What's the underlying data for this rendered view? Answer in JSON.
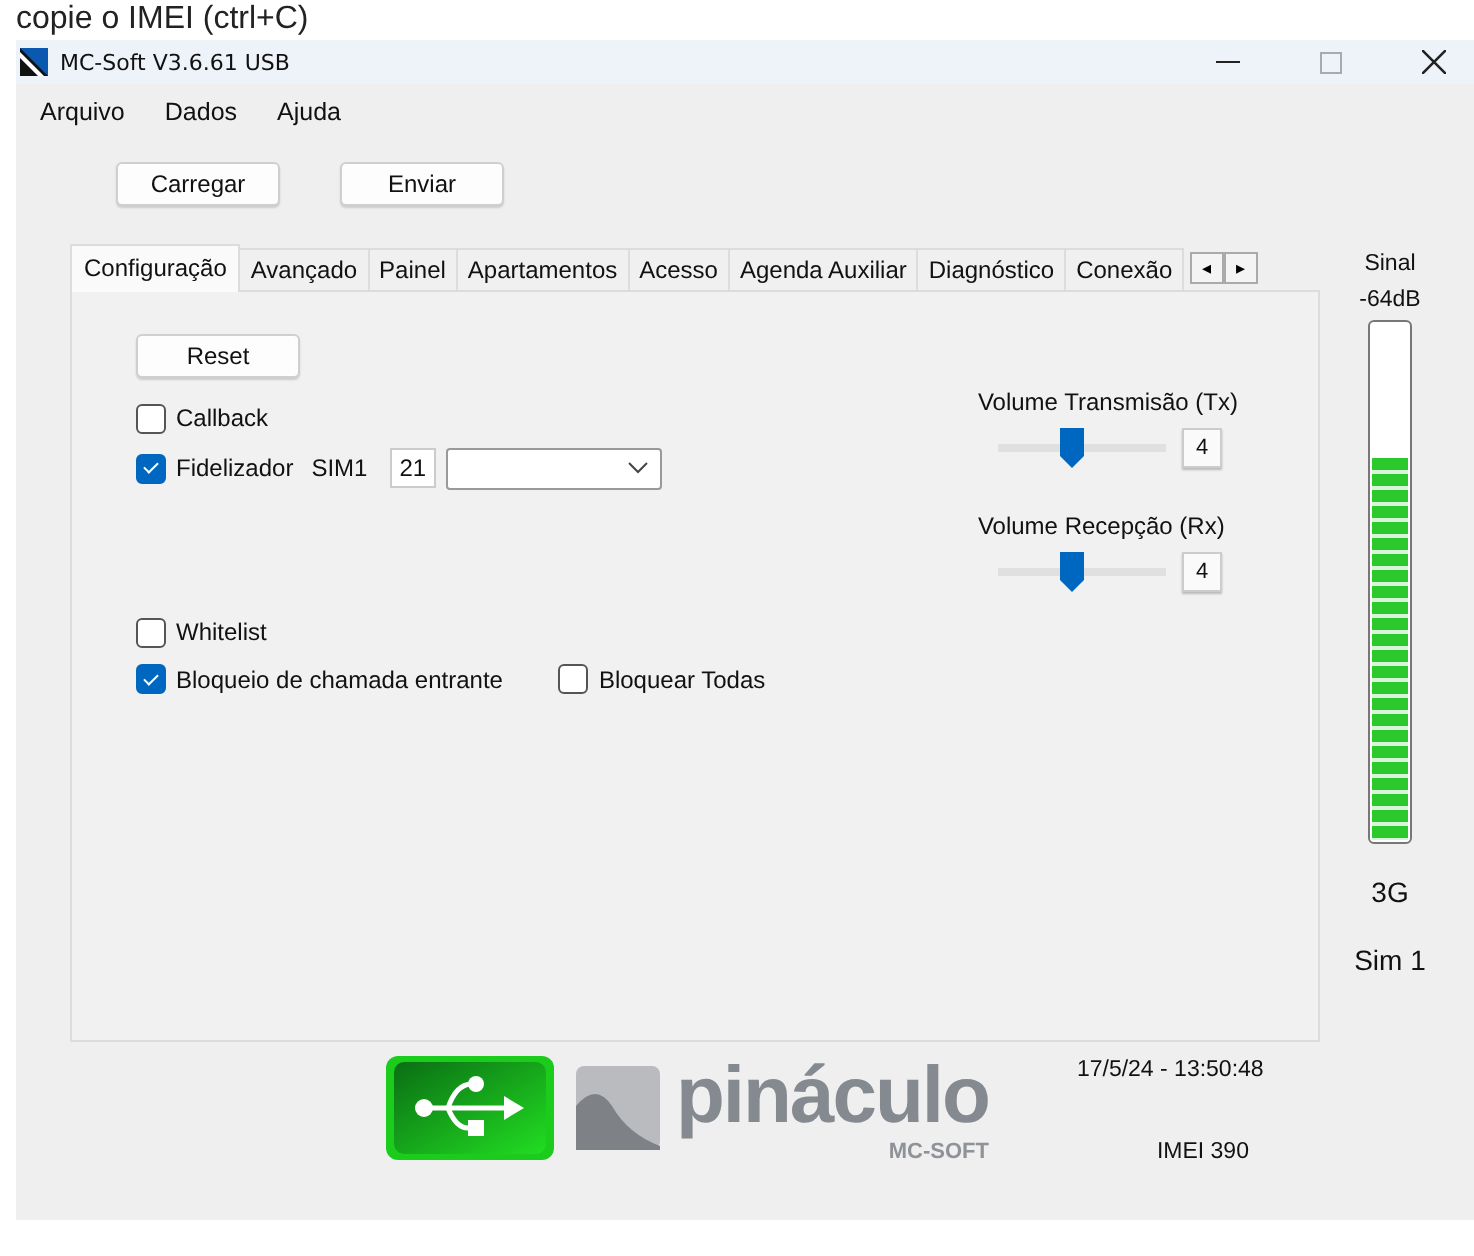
{
  "caption": "copie o IMEI (ctrl+C)",
  "window": {
    "title": "MC-Soft V3.6.61 USB"
  },
  "menu": [
    "Arquivo",
    "Dados",
    "Ajuda"
  ],
  "toolbar_buttons": [
    "Carregar",
    "Enviar"
  ],
  "tabs": [
    {
      "label": "Configuração",
      "selected": true
    },
    {
      "label": "Avançado",
      "selected": false
    },
    {
      "label": "Painel",
      "selected": false
    },
    {
      "label": "Apartamentos",
      "selected": false
    },
    {
      "label": "Acesso",
      "selected": false
    },
    {
      "label": "Agenda Auxiliar",
      "selected": false
    },
    {
      "label": "Diagnóstico",
      "selected": false
    },
    {
      "label": "Conexão",
      "selected": false
    }
  ],
  "tab_scroll": [
    "◂",
    "▸"
  ],
  "reset_button": "Reset",
  "callback": {
    "label": "Callback",
    "checked": false
  },
  "fidelizador": {
    "label": "Fidelizador",
    "checked": true,
    "sim_label": "SIM1",
    "number": "21"
  },
  "whitelist": {
    "label": "Whitelist",
    "checked": false
  },
  "bloqueio": {
    "label": "Bloqueio de chamada entrante",
    "checked": true
  },
  "bloquear_todas": {
    "label": "Bloquear Todas",
    "checked": false
  },
  "volumes": [
    {
      "label": "Volume Transmisão (Tx)",
      "level": 0.44,
      "value": "4"
    },
    {
      "label": "Volume Recepção (Rx)",
      "level": 0.44,
      "value": "4"
    }
  ],
  "signal": {
    "label": "Sinal",
    "reading": "-64dB",
    "level": 0.74,
    "network": "3G",
    "sim": "Sim 1"
  },
  "logo": {
    "word": "pináculo",
    "sub": "MC-SOFT"
  },
  "datetime": "17/5/24 - 13:50:48",
  "imei": "IMEI 390"
}
